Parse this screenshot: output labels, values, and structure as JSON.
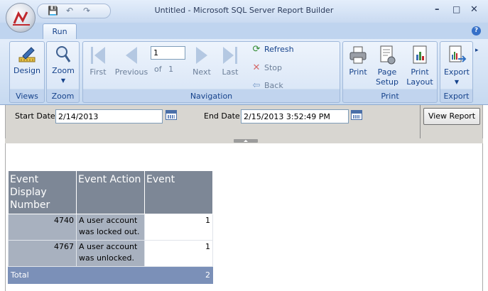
{
  "window": {
    "title": "Untitled - Microsoft SQL Server Report Builder",
    "minimize": "–",
    "maximize": "□",
    "close": "✕"
  },
  "tabs": [
    {
      "label": "Run"
    }
  ],
  "ribbon": {
    "views": {
      "label": "Views",
      "design": "Design"
    },
    "zoom": {
      "label": "Zoom",
      "zoom": "Zoom"
    },
    "navigation": {
      "label": "Navigation",
      "first": "First",
      "previous": "Previous",
      "page_value": "1",
      "of_label": "of",
      "total_pages": "1",
      "next": "Next",
      "last": "Last",
      "refresh": "Refresh",
      "stop": "Stop",
      "back": "Back"
    },
    "print": {
      "label": "Print",
      "print": "Print",
      "page_setup": "Page Setup",
      "print_layout": "Print Layout"
    },
    "export": {
      "label": "Export",
      "export": "Export"
    }
  },
  "parameters": {
    "start_date_label": "Start Date",
    "start_date_value": "2/14/2013",
    "end_date_label": "End Date",
    "end_date_value": "2/15/2013 3:52:49 PM",
    "view_report": "View Report"
  },
  "report": {
    "headers": [
      "Event Display Number",
      "Event Action",
      "Event"
    ],
    "rows": [
      {
        "number": "4740",
        "action": "A user account was locked out.",
        "count": "1"
      },
      {
        "number": "4767",
        "action": "A user account was unlocked.",
        "count": "1"
      }
    ],
    "total_label": "Total",
    "total_value": "2"
  },
  "colors": {
    "header_bg": "#7d8796",
    "row_bg": "#a8b1bf",
    "total_bg": "#7b90b8",
    "ribbon": "#dbe7f7"
  }
}
